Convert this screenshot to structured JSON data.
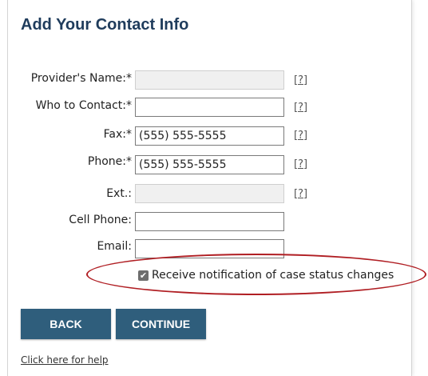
{
  "form": {
    "title": "Add Your Contact Info",
    "help_glyph": "[?]",
    "fields": [
      {
        "label": "Provider's Name:*",
        "value": "",
        "placeholder": ""
      },
      {
        "label": "Who to Contact:*",
        "value": "",
        "placeholder": ""
      },
      {
        "label": "Fax:*",
        "value": "(555) 555-5555",
        "placeholder": ""
      },
      {
        "label": "Phone:*",
        "value": "(555) 555-5555",
        "placeholder": ""
      },
      {
        "label": "Ext.:",
        "value": "",
        "placeholder": ""
      },
      {
        "label": "Cell Phone:",
        "value": "",
        "placeholder": ""
      },
      {
        "label": "Email:",
        "value": "",
        "placeholder": ""
      }
    ],
    "notify_checkbox": {
      "label": "Receive notification of case status changes",
      "checked": true,
      "glyph": "✔"
    },
    "back_label": "BACK",
    "continue_label": "CONTINUE",
    "help_link": "Click here for help"
  },
  "colors": {
    "title": "#1f3c5c",
    "button": "#2f5e7c",
    "highlight": "#b01e23"
  }
}
